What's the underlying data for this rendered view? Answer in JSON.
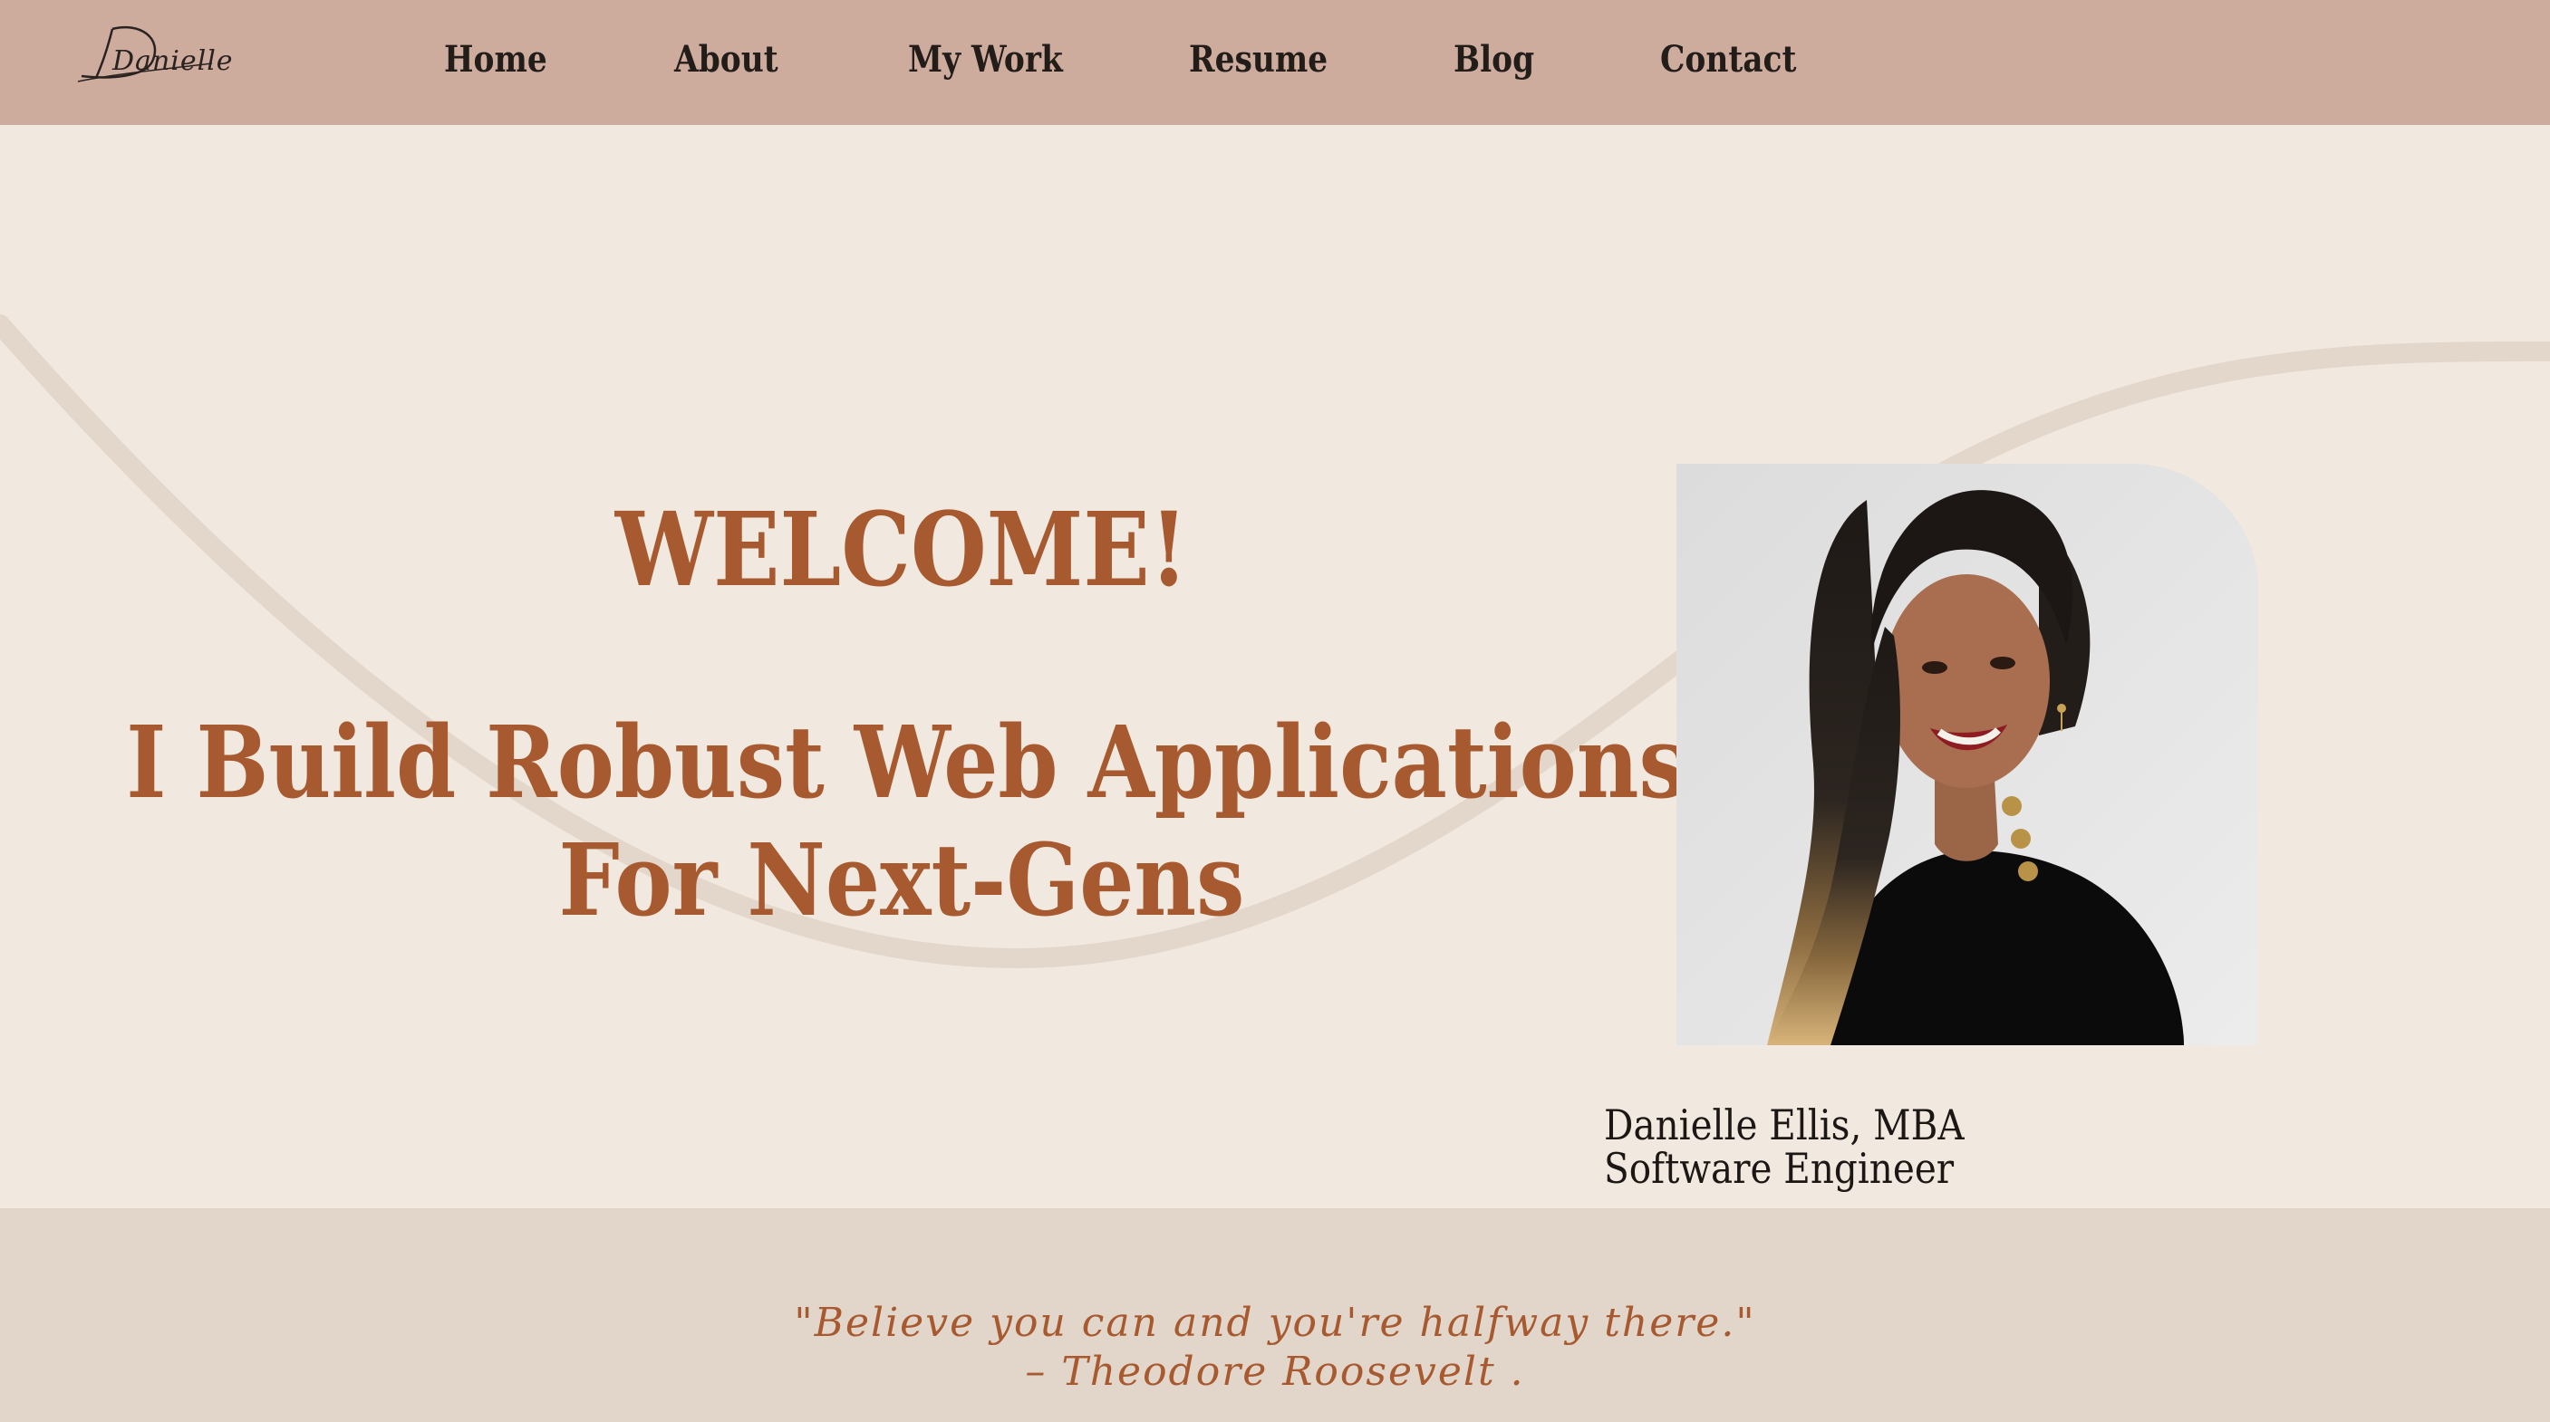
{
  "nav": {
    "logo_text": "Danielle",
    "items": [
      {
        "label": "Home"
      },
      {
        "label": "About"
      },
      {
        "label": "My Work"
      },
      {
        "label": "Resume"
      },
      {
        "label": "Blog"
      },
      {
        "label": "Contact"
      }
    ]
  },
  "hero": {
    "welcome": "WELCOME!",
    "headline_line1": "I Build Robust Web Applications",
    "headline_line2": "For Next-Gens",
    "caption_name": "Danielle Ellis, MBA",
    "caption_title": "Software Engineer"
  },
  "quote": {
    "text": "\"Believe you can and you're halfway there.\"",
    "author": "– Theodore Roosevelt ."
  },
  "colors": {
    "nav_bg": "#cdab9d",
    "page_bg": "#f1e9df",
    "accent": "#a75a30",
    "quote_band_bg": "#e2d5c9",
    "curve": "#e3d6ca"
  }
}
